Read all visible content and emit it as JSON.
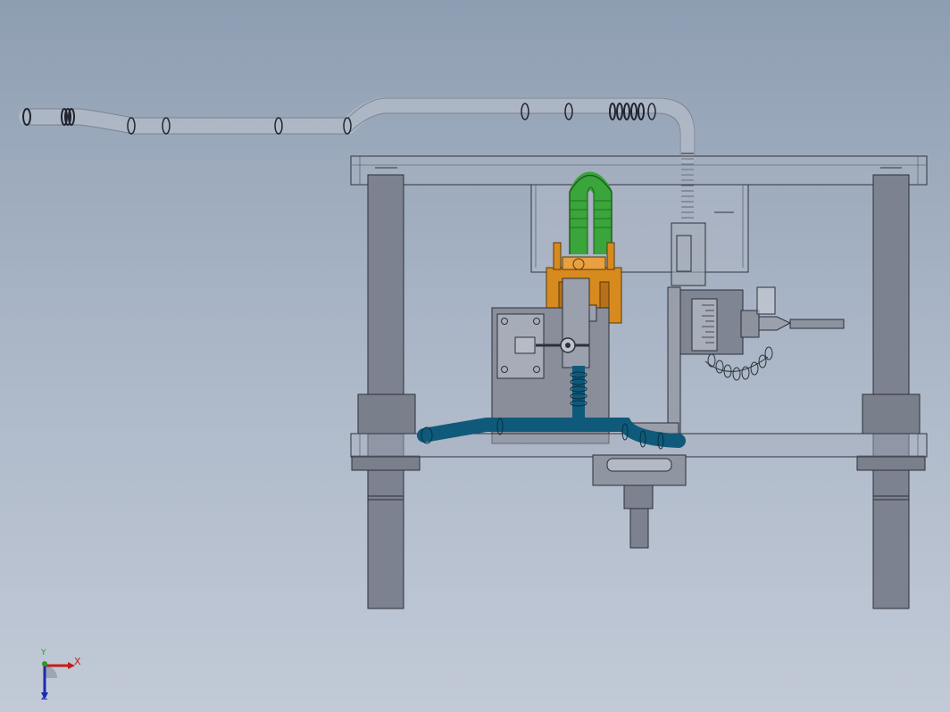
{
  "triad": {
    "x_label": "X",
    "y_label": "Y",
    "z_label": "Z",
    "x_color": "#c0201a",
    "y_color": "#2a9a2a",
    "z_color": "#1a2ab0"
  },
  "colors": {
    "background_top": "#8e9eb2",
    "background_bottom": "#c2cad7",
    "frame_gray": "#7d8290",
    "green_hose": "#3aa53a",
    "blue_hose": "#0f5a7a",
    "orange_clamp": "#d78a1e"
  },
  "icons": {
    "triad": "coordinate-triad-icon"
  }
}
